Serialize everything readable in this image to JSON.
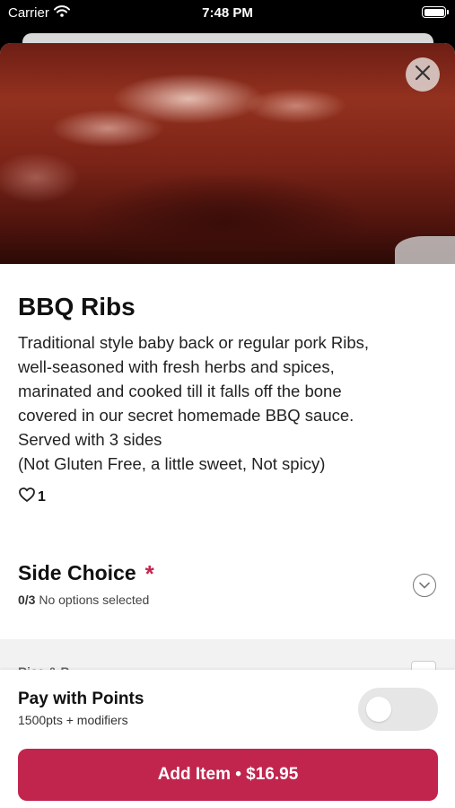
{
  "status_bar": {
    "carrier": "Carrier",
    "time": "7:48 PM"
  },
  "item": {
    "title": "BBQ Ribs",
    "description": "Traditional style baby back or regular pork Ribs,\nwell-seasoned with fresh herbs and spices,\nmarinated and cooked till it falls off the bone\ncovered in our secret homemade BBQ sauce.\nServed with 3 sides\n(Not Gluten Free, a little sweet, Not spicy)",
    "likes": "1"
  },
  "side_choice": {
    "title": "Side Choice",
    "required_mark": "*",
    "count": "0/3",
    "status": "No options selected"
  },
  "options": {
    "peek_label": "Rice & B"
  },
  "footer": {
    "points_title": "Pay with Points",
    "points_sub": "1500pts + modifiers",
    "toggle_on": false,
    "add_button": "Add Item • $16.95"
  },
  "colors": {
    "accent": "#c1254e",
    "required": "#c4254d"
  },
  "icons": [
    "wifi-icon",
    "battery-icon",
    "close-icon",
    "heart-icon",
    "chevron-down-icon"
  ]
}
